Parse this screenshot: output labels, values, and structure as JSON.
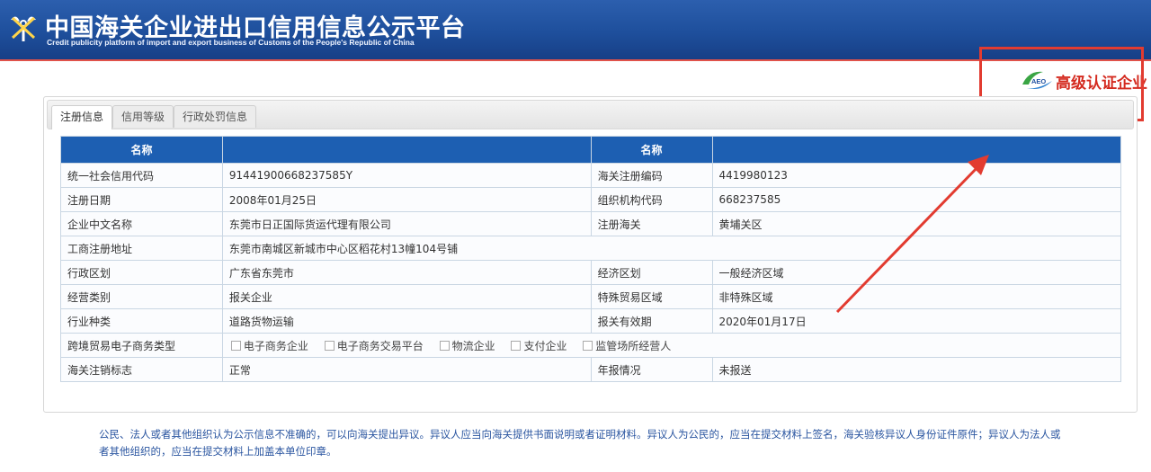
{
  "header": {
    "title": "中国海关企业进出口信用信息公示平台",
    "subtitle": "Credit publicity platform of import and export business of Customs of the People's Republic of China"
  },
  "badge": {
    "logo_text": "AEO",
    "label": "高级认证企业",
    "color": "#d42a1f"
  },
  "tabs": [
    {
      "label": "注册信息",
      "active": true
    },
    {
      "label": "信用等级",
      "active": false
    },
    {
      "label": "行政处罚信息",
      "active": false
    }
  ],
  "table": {
    "headers": [
      "名称",
      "",
      "名称",
      ""
    ],
    "rows": {
      "credit_code": {
        "label": "统一社会信用代码",
        "value": "91441900668237585Y",
        "label2": "海关注册编码",
        "value2": "4419980123"
      },
      "reg_date": {
        "label": "注册日期",
        "value": "2008年01月25日",
        "label2": "组织机构代码",
        "value2": "668237585"
      },
      "cn_name": {
        "label": "企业中文名称",
        "value": "东莞市日正国际货运代理有限公司",
        "label2": "注册海关",
        "value2": "黄埔关区"
      },
      "address": {
        "label": "工商注册地址",
        "value": "东莞市南城区新城市中心区稻花村13幢104号铺"
      },
      "admin_area": {
        "label": "行政区划",
        "value": "广东省东莞市",
        "label2": "经济区划",
        "value2": "一般经济区域"
      },
      "biz_type": {
        "label": "经营类别",
        "value": "报关企业",
        "label2": "特殊贸易区域",
        "value2": "非特殊区域"
      },
      "industry": {
        "label": "行业种类",
        "value": "道路货物运输",
        "label2": "报关有效期",
        "value2": "2020年01月17日"
      },
      "ecommerce": {
        "label": "跨境贸易电子商务类型",
        "options": [
          "电子商务企业",
          "电子商务交易平台",
          "物流企业",
          "支付企业",
          "监管场所经营人"
        ]
      },
      "cancel": {
        "label": "海关注销标志",
        "value": "正常",
        "label2": "年报情况",
        "value2": "未报送"
      }
    }
  },
  "notice": "公民、法人或者其他组织认为公示信息不准确的，可以向海关提出异议。异议人应当向海关提供书面说明或者证明材料。异议人为公民的，应当在提交材料上签名，海关验核异议人身份证件原件；异议人为法人或者其他组织的，应当在提交材料上加盖本单位印章。",
  "colors": {
    "header_blue": "#1e4f9c",
    "table_header_blue": "#1d5fb2",
    "highlight_red": "#e23b30",
    "notice_blue": "#2a55a0"
  }
}
